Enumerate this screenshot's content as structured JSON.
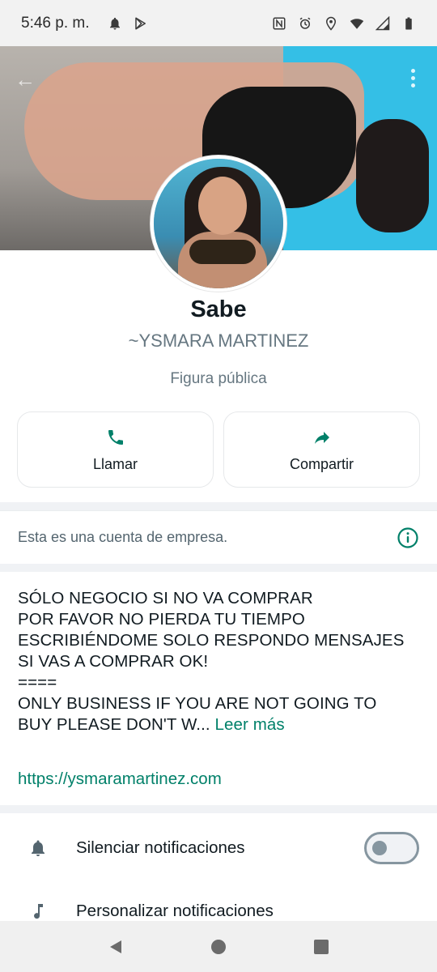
{
  "status_bar": {
    "time": "5:46 p. m.",
    "left_icons": [
      "bell-icon",
      "play-store-icon"
    ],
    "right_icons": [
      "nfc-icon",
      "alarm-icon",
      "location-icon",
      "wifi-icon",
      "signal-icon",
      "battery-icon"
    ]
  },
  "cover": {
    "icons": [
      "back-arrow-icon",
      "more-vertical-icon"
    ]
  },
  "profile": {
    "name": "Sabe",
    "push_name": "~YSMARA MARTINEZ",
    "category": "Figura pública"
  },
  "actions": [
    {
      "label": "Llamar",
      "icon": "phone-icon"
    },
    {
      "label": "Compartir",
      "icon": "share-icon"
    }
  ],
  "business_notice": {
    "text": "Esta es una cuenta de empresa.",
    "icon": "info-icon"
  },
  "about": {
    "lines": [
      "SÓLO NEGOCIO SI NO VA COMPRAR",
      "POR FAVOR NO PIERDA TU TIEMPO",
      "ESCRIBIÉNDOME SOLO RESPONDO MENSAJES",
      "SI VAS A COMPRAR OK!",
      "====",
      "ONLY BUSINESS IF YOU ARE NOT GOING TO",
      "BUY PLEASE DON'T W..."
    ],
    "read_more": "Leer más",
    "website": "https://ysmaramartinez.com"
  },
  "settings": [
    {
      "label": "Silenciar notificaciones",
      "icon": "bell-icon",
      "toggle": false
    },
    {
      "label": "Personalizar notificaciones",
      "icon": "music-note-icon"
    }
  ],
  "nav": [
    "back-triangle-icon",
    "home-circle-icon",
    "recents-square-icon"
  ],
  "colors": {
    "accent": "#008069",
    "text_primary": "#111b21",
    "text_secondary": "#667781",
    "divider": "#f0f2f5"
  }
}
